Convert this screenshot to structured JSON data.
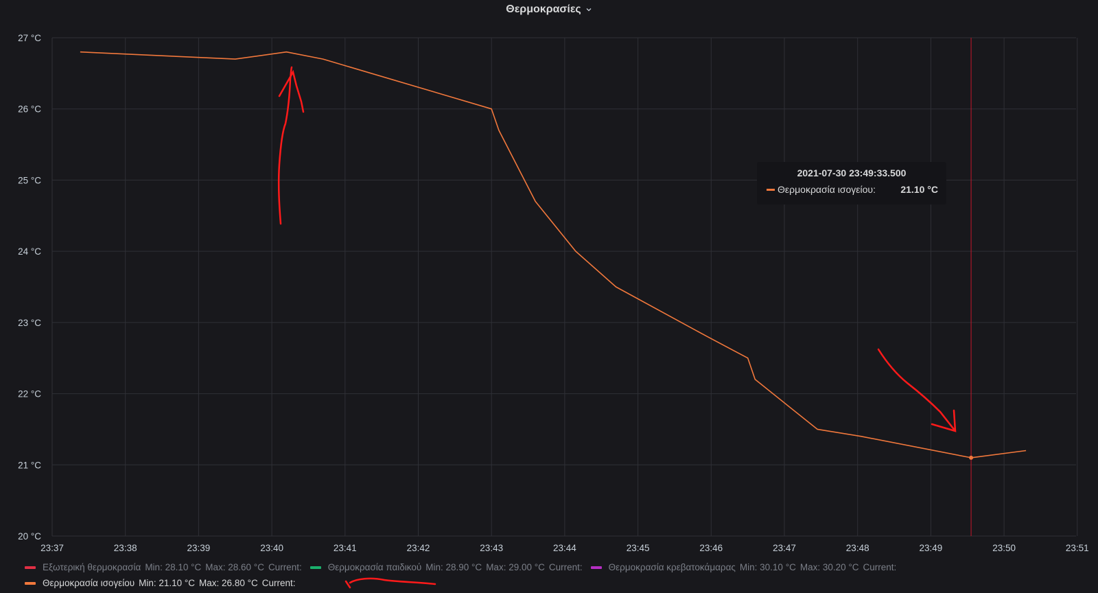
{
  "panel": {
    "title": "Θερμοκρασίες",
    "dropdown_icon": "chevron-down-icon"
  },
  "colors": {
    "background": "#18181c",
    "grid": "#2f3036",
    "axis_text": "#c7d0d9",
    "series_exterior": "#e02f44",
    "series_kids": "#1ab06c",
    "series_bedroom": "#b52ec2",
    "series_ground": "#f2783c",
    "cursor": "#c4162a"
  },
  "chart_data": {
    "type": "line",
    "title": "Θερμοκρασίες",
    "xlabel": "",
    "ylabel": "",
    "x_ticks": [
      "23:37",
      "23:38",
      "23:39",
      "23:40",
      "23:41",
      "23:42",
      "23:43",
      "23:44",
      "23:45",
      "23:46",
      "23:47",
      "23:48",
      "23:49",
      "23:50",
      "23:51"
    ],
    "y_ticks": [
      "20 °C",
      "21 °C",
      "22 °C",
      "23 °C",
      "24 °C",
      "25 °C",
      "26 °C",
      "27 °C"
    ],
    "xlim": [
      "23:37",
      "23:51"
    ],
    "ylim": [
      20,
      27
    ],
    "grid": true,
    "legend_position": "bottom",
    "series": [
      {
        "name": "Θερμοκρασία ισογείου",
        "color": "#f2783c",
        "x": [
          "23:37:23",
          "23:39:30",
          "23:40:12",
          "23:40:42",
          "23:43:00",
          "23:43:06",
          "23:43:36",
          "23:44:09",
          "23:44:42",
          "23:45:57",
          "23:46:30",
          "23:46:36",
          "23:47:27",
          "23:48:03",
          "23:49:33",
          "23:50:18"
        ],
        "y": [
          26.8,
          26.7,
          26.8,
          26.7,
          26.0,
          25.7,
          24.7,
          24.0,
          23.5,
          22.8,
          22.5,
          22.2,
          21.5,
          21.4,
          21.1,
          21.2
        ]
      }
    ]
  },
  "legend": {
    "items": [
      {
        "name": "Εξωτερική θερμοκρασία",
        "min": "Min: 28.10 °C",
        "max": "Max: 28.60 °C",
        "current": "Current:"
      },
      {
        "name": "Θερμοκρασία παιδικού",
        "min": "Min: 28.90 °C",
        "max": "Max: 29.00 °C",
        "current": "Current:"
      },
      {
        "name": "Θερμοκρασία κρεβατοκάμαρας",
        "min": "Min: 30.10 °C",
        "max": "Max: 30.20 °C",
        "current": "Current:"
      },
      {
        "name": "Θερμοκρασία ισογείου",
        "min": "Min: 21.10 °C",
        "max": "Max: 26.80 °C",
        "current": "Current:"
      }
    ]
  },
  "tooltip": {
    "time": "2021-07-30 23:49:33.500",
    "series": "Θερμοκρασία ισογείου:",
    "value": "21.10 °C",
    "at_x": "23:49:33"
  }
}
